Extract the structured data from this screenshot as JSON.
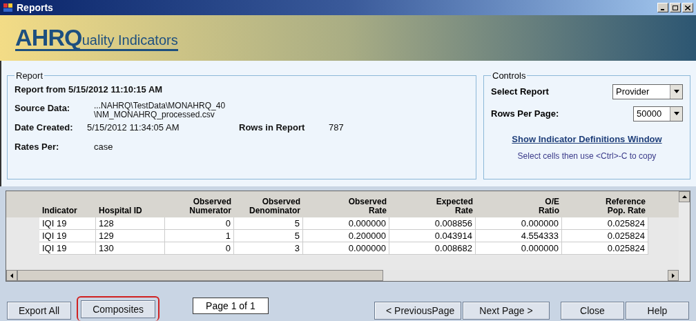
{
  "window": {
    "title": "Reports"
  },
  "banner": {
    "logo_big": "AHRQ",
    "logo_rest": "uality Indicators"
  },
  "report": {
    "legend": "Report",
    "heading": "Report from 5/15/2012 11:10:15 AM",
    "source_label": "Source Data:",
    "source_lines": [
      "...NAHRQ\\TestData\\MONAHRQ_40",
      "\\NM_MONAHRQ_processed.csv"
    ],
    "date_label": "Date Created:",
    "date_value": "5/15/2012 11:34:05 AM",
    "rows_label": "Rows in Report",
    "rows_value": "787",
    "rates_label": "Rates Per:",
    "rates_value": "case"
  },
  "controls": {
    "legend": "Controls",
    "select_report_label": "Select Report",
    "select_report_value": "Provider",
    "rows_per_page_label": "Rows Per Page:",
    "rows_per_page_value": "50000",
    "link": "Show Indicator Definitions Window",
    "hint": "Select cells then use <Ctrl>-C to copy"
  },
  "table": {
    "columns": [
      {
        "label": [
          "Indicator"
        ]
      },
      {
        "label": [
          "Hospital ID"
        ]
      },
      {
        "label": [
          "Observed",
          "Numerator"
        ]
      },
      {
        "label": [
          "Observed",
          "Denominator"
        ]
      },
      {
        "label": [
          "Observed",
          "Rate"
        ]
      },
      {
        "label": [
          "Expected",
          "Rate"
        ]
      },
      {
        "label": [
          "O/E",
          "Ratio"
        ]
      },
      {
        "label": [
          "Reference",
          "Pop. Rate"
        ]
      }
    ],
    "rows": [
      [
        "IQI 19",
        "128",
        "0",
        "5",
        "0.000000",
        "0.008856",
        "0.000000",
        "0.025824"
      ],
      [
        "IQI 19",
        "129",
        "1",
        "5",
        "0.200000",
        "0.043914",
        "4.554333",
        "0.025824"
      ],
      [
        "IQI 19",
        "130",
        "0",
        "3",
        "0.000000",
        "0.008682",
        "0.000000",
        "0.025824"
      ]
    ]
  },
  "footer": {
    "buttons": [
      {
        "label": "Export All",
        "highlighted": false
      },
      {
        "label": "Composites",
        "highlighted": true
      }
    ],
    "page": "Page 1 of 1",
    "nav_buttons": [
      {
        "label": "< PreviousPage"
      },
      {
        "label": "Next Page >"
      }
    ],
    "end_buttons": [
      {
        "label": "Close"
      },
      {
        "label": "Help"
      }
    ]
  }
}
